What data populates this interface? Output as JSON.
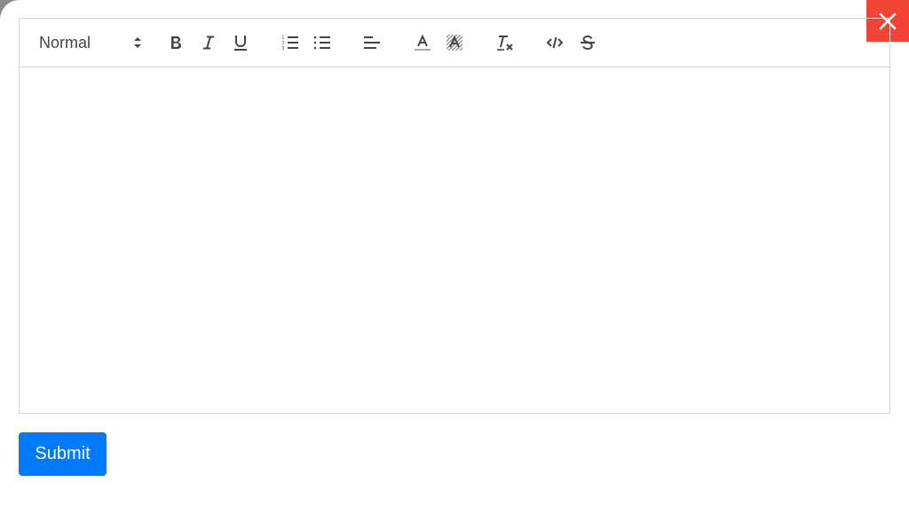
{
  "close": {
    "icon": "close-icon",
    "color": "#f44336"
  },
  "toolbar": {
    "heading_picker": {
      "selected": "Normal",
      "icon": "updown-arrows-icon"
    },
    "buttons": [
      {
        "name": "bold",
        "icon": "bold-icon"
      },
      {
        "name": "italic",
        "icon": "italic-icon"
      },
      {
        "name": "underline",
        "icon": "underline-icon"
      },
      {
        "name": "ordered-list",
        "icon": "ordered-list-icon"
      },
      {
        "name": "bullet-list",
        "icon": "bullet-list-icon"
      },
      {
        "name": "align",
        "icon": "align-left-icon"
      },
      {
        "name": "text-color",
        "icon": "text-color-icon"
      },
      {
        "name": "background-color",
        "icon": "background-color-icon"
      },
      {
        "name": "clear-format",
        "icon": "clear-format-icon"
      },
      {
        "name": "code",
        "icon": "code-icon"
      },
      {
        "name": "strike",
        "icon": "strike-icon"
      }
    ]
  },
  "editor": {
    "content": ""
  },
  "submit": {
    "label": "Submit",
    "color": "#007bff"
  }
}
